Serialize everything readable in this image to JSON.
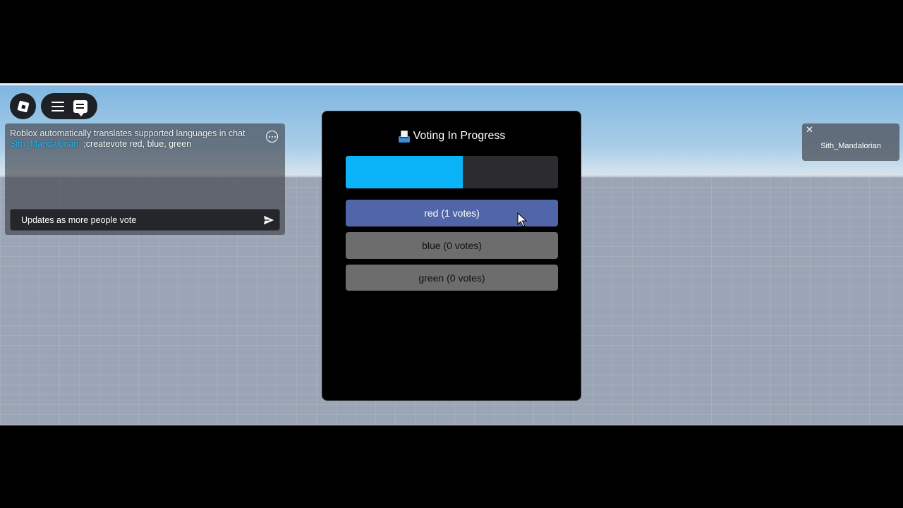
{
  "topbar": {
    "roblox_icon": "roblox-logo-icon",
    "menu_icon": "hamburger-icon",
    "chat_icon": "chat-icon"
  },
  "chat": {
    "notice": "Roblox automatically translates supported languages in chat",
    "messages": [
      {
        "user": "Sith_Mandalorian:",
        "text": " ;createvote red, blue, green"
      }
    ],
    "input_text": "Updates as more people vote",
    "options_icon": "more-options-icon",
    "send_icon": "send-icon"
  },
  "vote": {
    "title": "Voting In Progress",
    "title_icon": "ballot-box-icon",
    "progress_fraction": 0.55,
    "options": [
      {
        "label": "red (1 votes)",
        "color": "#5166a8"
      },
      {
        "label": "blue (0 votes)",
        "color": "#6d6d6d"
      },
      {
        "label": "green (0 votes)",
        "color": "#6d6d6d"
      }
    ],
    "progress_color": "#0bb3f9"
  },
  "player_list": {
    "close_label": "✕",
    "player_name": "Sith_Mandalorian"
  }
}
